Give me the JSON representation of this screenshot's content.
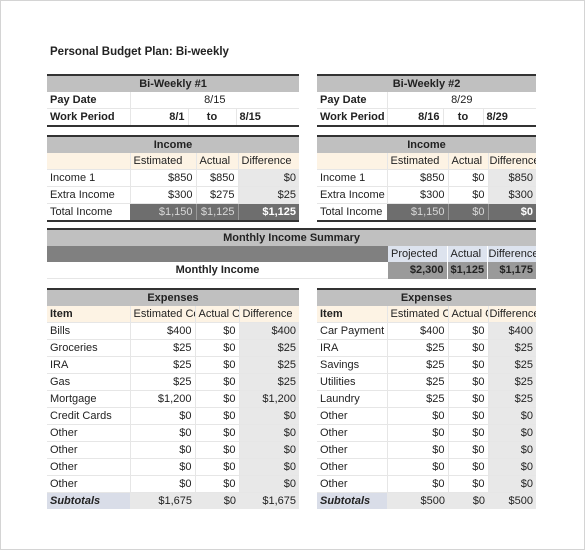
{
  "title": "Personal Budget Plan: Bi-weekly",
  "periods": [
    {
      "header": "Bi-Weekly #1",
      "pay_date_label": "Pay Date",
      "pay_date": "8/15",
      "work_period_label": "Work Period",
      "work_start": "8/1",
      "work_to": "to",
      "work_end": "8/15",
      "income": {
        "header": "Income",
        "columns": [
          "Estimated",
          "Actual",
          "Difference"
        ],
        "rows": [
          {
            "label": "Income 1",
            "estimated": "$850",
            "actual": "$850",
            "difference": "$0"
          },
          {
            "label": "Extra Income",
            "estimated": "$300",
            "actual": "$275",
            "difference": "$25"
          }
        ],
        "total": {
          "label": "Total Income",
          "estimated": "$1,150",
          "actual": "$1,125",
          "difference": "$1,125"
        }
      },
      "expenses": {
        "header": "Expenses",
        "columns": [
          "Item",
          "Estimated Co",
          "Actual O",
          "Difference"
        ],
        "rows": [
          {
            "item": "Bills",
            "estimated": "$400",
            "actual": "$0",
            "difference": "$400"
          },
          {
            "item": "Groceries",
            "estimated": "$25",
            "actual": "$0",
            "difference": "$25"
          },
          {
            "item": "IRA",
            "estimated": "$25",
            "actual": "$0",
            "difference": "$25"
          },
          {
            "item": "Gas",
            "estimated": "$25",
            "actual": "$0",
            "difference": "$25"
          },
          {
            "item": "Mortgage",
            "estimated": "$1,200",
            "actual": "$0",
            "difference": "$1,200"
          },
          {
            "item": "Credit Cards",
            "estimated": "$0",
            "actual": "$0",
            "difference": "$0"
          },
          {
            "item": "Other",
            "estimated": "$0",
            "actual": "$0",
            "difference": "$0"
          },
          {
            "item": "Other",
            "estimated": "$0",
            "actual": "$0",
            "difference": "$0"
          },
          {
            "item": "Other",
            "estimated": "$0",
            "actual": "$0",
            "difference": "$0"
          },
          {
            "item": "Other",
            "estimated": "$0",
            "actual": "$0",
            "difference": "$0"
          }
        ],
        "subtotal": {
          "label": "Subtotals",
          "estimated": "$1,675",
          "actual": "$0",
          "difference": "$1,675"
        }
      }
    },
    {
      "header": "Bi-Weekly #2",
      "pay_date_label": "Pay Date",
      "pay_date": "8/29",
      "work_period_label": "Work Period",
      "work_start": "8/16",
      "work_to": "to",
      "work_end": "8/29",
      "income": {
        "header": "Income",
        "columns": [
          "Estimated",
          "Actual",
          "Difference"
        ],
        "rows": [
          {
            "label": "Income 1",
            "estimated": "$850",
            "actual": "$0",
            "difference": "$850"
          },
          {
            "label": "Extra Income",
            "estimated": "$300",
            "actual": "$0",
            "difference": "$300"
          }
        ],
        "total": {
          "label": "Total Income",
          "estimated": "$1,150",
          "actual": "$0",
          "difference": "$0"
        }
      },
      "expenses": {
        "header": "Expenses",
        "columns": [
          "Item",
          "Estimated C",
          "Actual C",
          "Difference"
        ],
        "rows": [
          {
            "item": "Car Payment",
            "estimated": "$400",
            "actual": "$0",
            "difference": "$400"
          },
          {
            "item": "IRA",
            "estimated": "$25",
            "actual": "$0",
            "difference": "$25"
          },
          {
            "item": "Savings",
            "estimated": "$25",
            "actual": "$0",
            "difference": "$25"
          },
          {
            "item": "Utilities",
            "estimated": "$25",
            "actual": "$0",
            "difference": "$25"
          },
          {
            "item": "Laundry",
            "estimated": "$25",
            "actual": "$0",
            "difference": "$25"
          },
          {
            "item": "Other",
            "estimated": "$0",
            "actual": "$0",
            "difference": "$0"
          },
          {
            "item": "Other",
            "estimated": "$0",
            "actual": "$0",
            "difference": "$0"
          },
          {
            "item": "Other",
            "estimated": "$0",
            "actual": "$0",
            "difference": "$0"
          },
          {
            "item": "Other",
            "estimated": "$0",
            "actual": "$0",
            "difference": "$0"
          },
          {
            "item": "Other",
            "estimated": "$0",
            "actual": "$0",
            "difference": "$0"
          }
        ],
        "subtotal": {
          "label": "Subtotals",
          "estimated": "$500",
          "actual": "$0",
          "difference": "$500"
        }
      }
    }
  ],
  "summary": {
    "header": "Monthly Income Summary",
    "columns": [
      "Projected",
      "Actual",
      "Difference"
    ],
    "row_label": "Monthly Income",
    "projected": "$2,300",
    "actual": "$1,125",
    "difference": "$1,175"
  }
}
